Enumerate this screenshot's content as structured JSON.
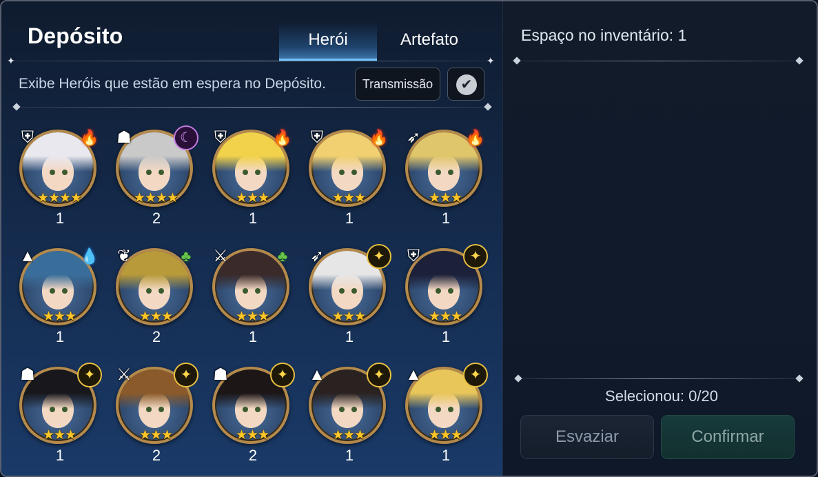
{
  "header": {
    "title": "Depósito",
    "tabs": [
      {
        "label": "Herói",
        "active": true
      },
      {
        "label": "Artefato",
        "active": false
      }
    ]
  },
  "filter": {
    "description": "Exibe Heróis que estão em espera no Depósito.",
    "transmit_label": "Transmissão",
    "check_icon": "check-circle-icon"
  },
  "heroes": [
    {
      "class_icon": "knight-shield-icon",
      "element": "fire",
      "stars": 4,
      "count": "1",
      "hair": "#e8e8ee"
    },
    {
      "class_icon": "thief-hood-icon",
      "element": "dark",
      "stars": 4,
      "count": "2",
      "hair": "#c9c9c9"
    },
    {
      "class_icon": "knight-shield-icon",
      "element": "fire",
      "stars": 3,
      "count": "1",
      "hair": "#f2d24a"
    },
    {
      "class_icon": "knight-shield-icon",
      "element": "fire",
      "stars": 3,
      "count": "1",
      "hair": "#f0d070"
    },
    {
      "class_icon": "ranger-bow-icon",
      "element": "fire",
      "stars": 3,
      "count": "1",
      "hair": "#e0c66a"
    },
    {
      "class_icon": "mage-hat-icon",
      "element": "ice",
      "stars": 3,
      "count": "1",
      "hair": "#3a6e9a"
    },
    {
      "class_icon": "soul-weaver-icon",
      "element": "earth",
      "stars": 3,
      "count": "2",
      "hair": "#b89a3a"
    },
    {
      "class_icon": "warrior-sword-icon",
      "element": "earth",
      "stars": 3,
      "count": "1",
      "hair": "#3a2a2a"
    },
    {
      "class_icon": "ranger-bow-icon",
      "element": "light",
      "stars": 3,
      "count": "1",
      "hair": "#e6e6e6"
    },
    {
      "class_icon": "knight-shield-icon",
      "element": "light",
      "stars": 3,
      "count": "1",
      "hair": "#1c2038"
    },
    {
      "class_icon": "thief-hood-icon",
      "element": "light",
      "stars": 3,
      "count": "1",
      "hair": "#18181c"
    },
    {
      "class_icon": "warrior-sword-icon",
      "element": "light",
      "stars": 3,
      "count": "2",
      "hair": "#8a5a2a"
    },
    {
      "class_icon": "thief-hood-icon",
      "element": "light",
      "stars": 3,
      "count": "2",
      "hair": "#1c1616"
    },
    {
      "class_icon": "mage-hat-icon",
      "element": "light",
      "stars": 3,
      "count": "1",
      "hair": "#2a2220"
    },
    {
      "class_icon": "mage-hat-icon",
      "element": "light",
      "stars": 3,
      "count": "1",
      "hair": "#e8c65a"
    }
  ],
  "inventory": {
    "space_label": "Espaço no inventário: 1",
    "selected_label": "Selecionou: 0/20",
    "empty_button": "Esvaziar",
    "confirm_button": "Confirmar"
  },
  "colors": {
    "active_tab_glow": "#6fc3ff",
    "portrait_border": "#b48a4c",
    "star": "#ffc629"
  }
}
